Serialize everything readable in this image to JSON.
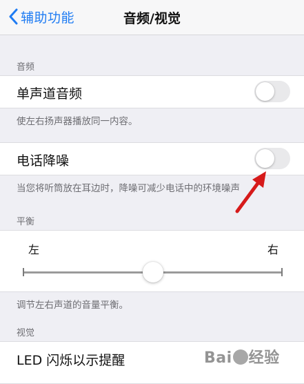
{
  "nav": {
    "back_label": "辅助功能",
    "title": "音频/视觉"
  },
  "colors": {
    "accent": "#1f7cf3",
    "toggle_off": "#e9e9eb",
    "arrow": "#d61a1a"
  },
  "audio_section": {
    "header": "音频",
    "mono_audio": {
      "label": "单声道音频",
      "state": "off"
    },
    "mono_footer": "使左右扬声器播放同一内容。",
    "noise_cancellation": {
      "label": "电话降噪",
      "state": "off"
    },
    "noise_footer": "当您将听筒放在耳边时，降噪可减少电话中的环境噪声"
  },
  "balance_section": {
    "header": "平衡",
    "left_label": "左",
    "right_label": "右",
    "value": 0.5,
    "footer": "调节左右声道的音量平衡。"
  },
  "visual_section": {
    "header": "视觉",
    "led_flash": {
      "label": "LED 闪烁以示提醒"
    }
  },
  "watermark": {
    "text_a": "Bai",
    "text_b": "经验"
  }
}
